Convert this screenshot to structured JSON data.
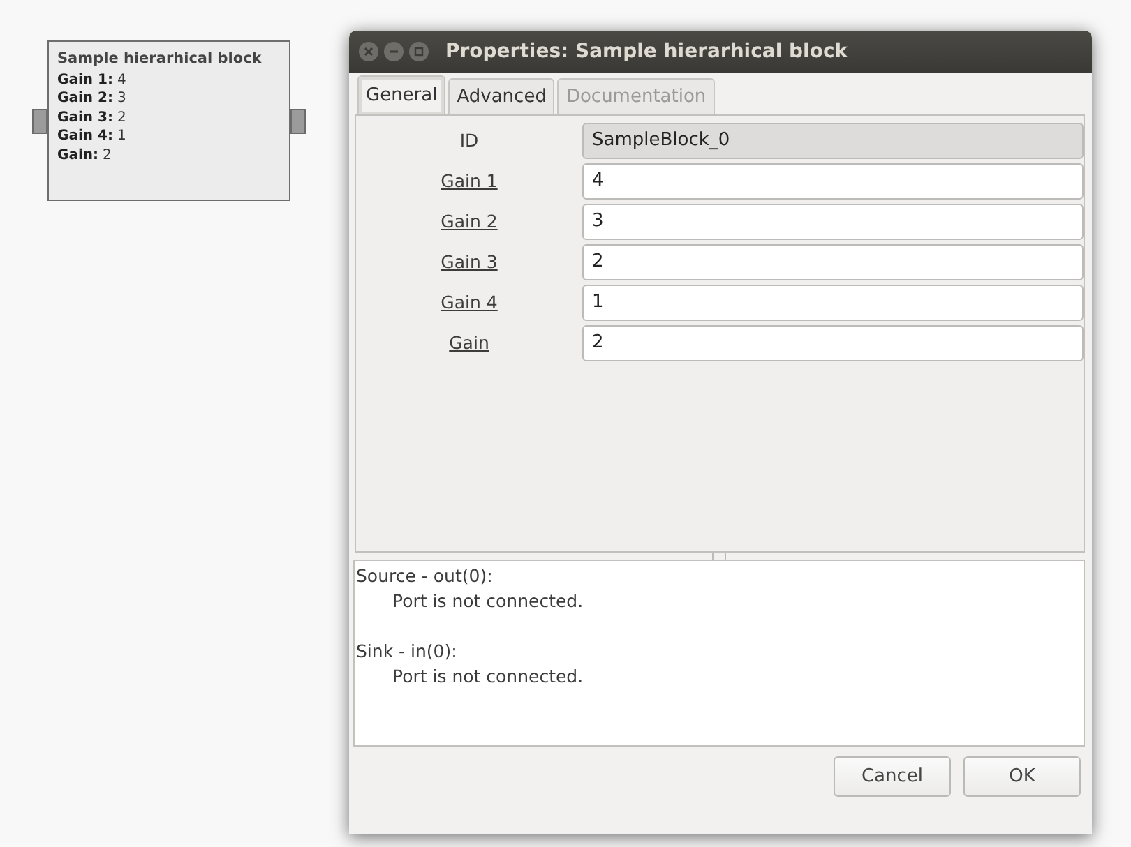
{
  "canvas": {
    "block": {
      "title": "Sample hierarhical block",
      "params": [
        {
          "name": "Gain 1:",
          "value": "4"
        },
        {
          "name": "Gain 2:",
          "value": "3"
        },
        {
          "name": "Gain 3:",
          "value": "2"
        },
        {
          "name": "Gain 4:",
          "value": "1"
        },
        {
          "name": "Gain:",
          "value": "2"
        }
      ]
    }
  },
  "dialog": {
    "title": "Properties: Sample hierarhical block",
    "tabs": [
      {
        "label": "General",
        "selected": true,
        "disabled": false
      },
      {
        "label": "Advanced",
        "selected": false,
        "disabled": false
      },
      {
        "label": "Documentation",
        "selected": false,
        "disabled": true
      }
    ],
    "params": [
      {
        "label": "ID",
        "value": "SampleBlock_0",
        "readonly": true
      },
      {
        "label": "Gain 1",
        "value": "4",
        "readonly": false
      },
      {
        "label": "Gain 2",
        "value": "3",
        "readonly": false
      },
      {
        "label": "Gain 3",
        "value": "2",
        "readonly": false
      },
      {
        "label": "Gain 4",
        "value": "1",
        "readonly": false
      },
      {
        "label": "Gain",
        "value": "2",
        "readonly": false
      }
    ],
    "messages": [
      {
        "heading": "Source - out(0):",
        "text": "Port is not connected."
      },
      {
        "heading": "Sink - in(0):",
        "text": "Port is not connected."
      }
    ],
    "buttons": [
      "Cancel",
      "OK"
    ]
  }
}
